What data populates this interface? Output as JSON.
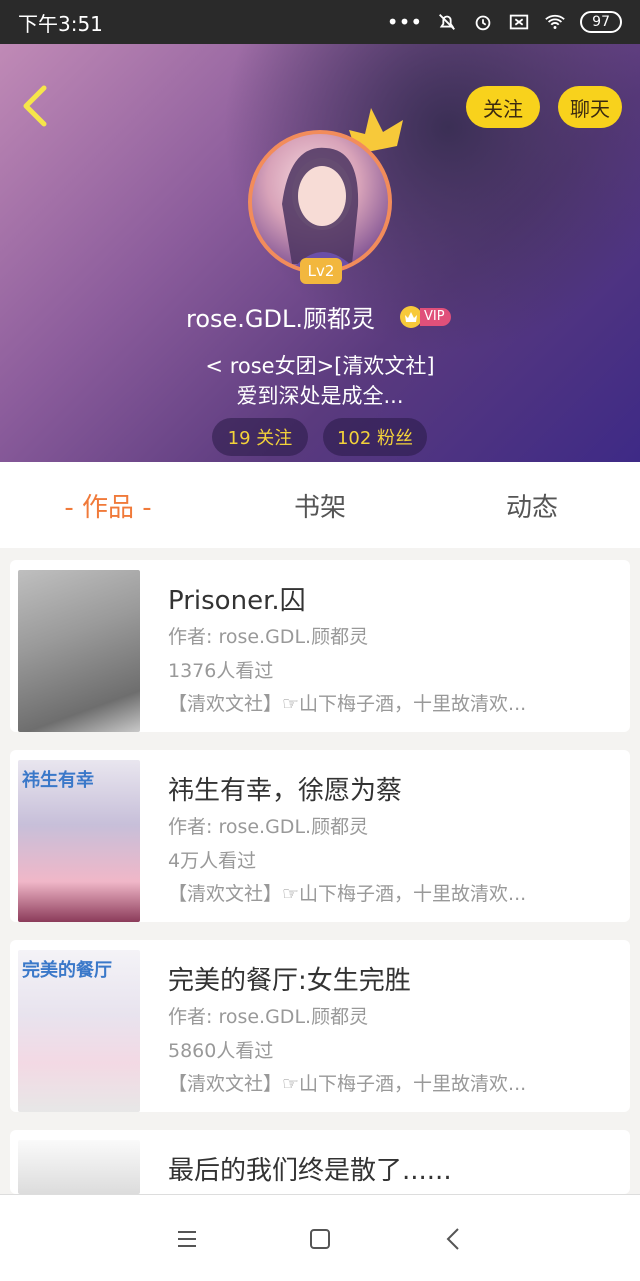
{
  "status": {
    "time": "下午3:51",
    "battery": "97"
  },
  "header": {
    "follow_label": "关注",
    "chat_label": "聊天",
    "level": "Lv2",
    "username": "rose.GDL.顾都灵",
    "vip": "VIP",
    "bio_line1": "< rose女团>[清欢文社]",
    "bio_line2": "爱到深处是成全...",
    "following": "19 关注",
    "fans": "102 粉丝"
  },
  "tabs": [
    "- 作品 -",
    "书架",
    "动态"
  ],
  "works": [
    {
      "thumb_text": "",
      "title": "Prisoner.囚",
      "author": "作者: rose.GDL.顾都灵",
      "views": "1376人看过",
      "desc": "【清欢文社】☞山下梅子酒，十里故清欢..."
    },
    {
      "thumb_text": "祎生有幸",
      "title": "祎生有幸，徐愿为蔡",
      "author": "作者: rose.GDL.顾都灵",
      "views": "4万人看过",
      "desc": "【清欢文社】☞山下梅子酒，十里故清欢..."
    },
    {
      "thumb_text": "完美的餐厅",
      "title": "完美的餐厅:女生完胜",
      "author": "作者: rose.GDL.顾都灵",
      "views": "5860人看过",
      "desc": "【清欢文社】☞山下梅子酒，十里故清欢..."
    },
    {
      "thumb_text": "",
      "title": "最后的我们终是散了......",
      "author": "",
      "views": "",
      "desc": ""
    }
  ],
  "colors": {
    "accent": "#f07a3a",
    "button_yellow": "#f8d21c",
    "pill_text": "#f3d23a"
  }
}
